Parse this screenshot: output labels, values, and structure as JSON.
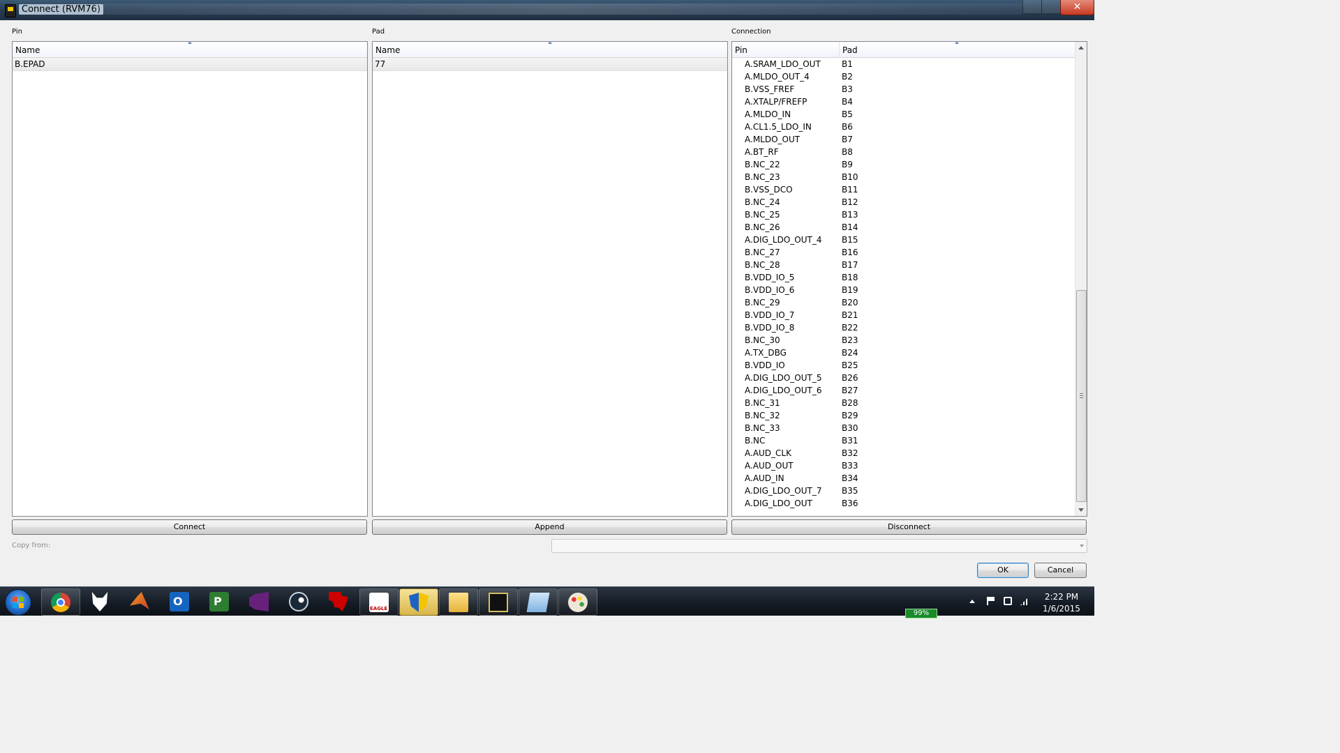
{
  "window": {
    "title": "Connect  (RVM76)"
  },
  "pin_panel": {
    "label": "Pin",
    "column": "Name",
    "rows": [
      "B.EPAD"
    ]
  },
  "pad_panel": {
    "label": "Pad",
    "column": "Name",
    "rows": [
      "77"
    ]
  },
  "connection_panel": {
    "label": "Connection",
    "columns": {
      "pin": "Pin",
      "pad": "Pad"
    },
    "rows": [
      {
        "pin": "A.SRAM_LDO_OUT",
        "pad": "B1"
      },
      {
        "pin": "A.MLDO_OUT_4",
        "pad": "B2"
      },
      {
        "pin": "B.VSS_FREF",
        "pad": "B3"
      },
      {
        "pin": "A.XTALP/FREFP",
        "pad": "B4"
      },
      {
        "pin": "A.MLDO_IN",
        "pad": "B5"
      },
      {
        "pin": "A.CL1.5_LDO_IN",
        "pad": "B6"
      },
      {
        "pin": "A.MLDO_OUT",
        "pad": "B7"
      },
      {
        "pin": "A.BT_RF",
        "pad": "B8"
      },
      {
        "pin": "B.NC_22",
        "pad": "B9"
      },
      {
        "pin": "B.NC_23",
        "pad": "B10"
      },
      {
        "pin": "B.VSS_DCO",
        "pad": "B11"
      },
      {
        "pin": "B.NC_24",
        "pad": "B12"
      },
      {
        "pin": "B.NC_25",
        "pad": "B13"
      },
      {
        "pin": "B.NC_26",
        "pad": "B14"
      },
      {
        "pin": "A.DIG_LDO_OUT_4",
        "pad": "B15"
      },
      {
        "pin": "B.NC_27",
        "pad": "B16"
      },
      {
        "pin": "B.NC_28",
        "pad": "B17"
      },
      {
        "pin": "B.VDD_IO_5",
        "pad": "B18"
      },
      {
        "pin": "B.VDD_IO_6",
        "pad": "B19"
      },
      {
        "pin": "B.NC_29",
        "pad": "B20"
      },
      {
        "pin": "B.VDD_IO_7",
        "pad": "B21"
      },
      {
        "pin": "B.VDD_IO_8",
        "pad": "B22"
      },
      {
        "pin": "B.NC_30",
        "pad": "B23"
      },
      {
        "pin": "A.TX_DBG",
        "pad": "B24"
      },
      {
        "pin": "B.VDD_IO",
        "pad": "B25"
      },
      {
        "pin": "A.DIG_LDO_OUT_5",
        "pad": "B26"
      },
      {
        "pin": "A.DIG_LDO_OUT_6",
        "pad": "B27"
      },
      {
        "pin": "B.NC_31",
        "pad": "B28"
      },
      {
        "pin": "B.NC_32",
        "pad": "B29"
      },
      {
        "pin": "B.NC_33",
        "pad": "B30"
      },
      {
        "pin": "B.NC",
        "pad": "B31"
      },
      {
        "pin": "A.AUD_CLK",
        "pad": "B32"
      },
      {
        "pin": "A.AUD_OUT",
        "pad": "B33"
      },
      {
        "pin": "A.AUD_IN",
        "pad": "B34"
      },
      {
        "pin": "A.DIG_LDO_OUT_7",
        "pad": "B35"
      },
      {
        "pin": "A.DIG_LDO_OUT",
        "pad": "B36"
      }
    ]
  },
  "buttons": {
    "connect": "Connect",
    "append": "Append",
    "disconnect": "Disconnect",
    "ok": "OK",
    "cancel": "Cancel"
  },
  "copy_from": {
    "label": "Copy from:",
    "value": ""
  },
  "taskbar": {
    "battery": "99%",
    "time": "2:22 PM",
    "date": "1/6/2015",
    "apps": [
      "chrome-icon",
      "fox-icon",
      "matlab-icon",
      "outlook-icon",
      "project-icon",
      "visual-studio-icon",
      "steam-icon",
      "ti-icon",
      "eagle-icon",
      "shield-icon",
      "folder-icon",
      "pcb-icon",
      "notepad-icon",
      "paint-icon"
    ]
  }
}
